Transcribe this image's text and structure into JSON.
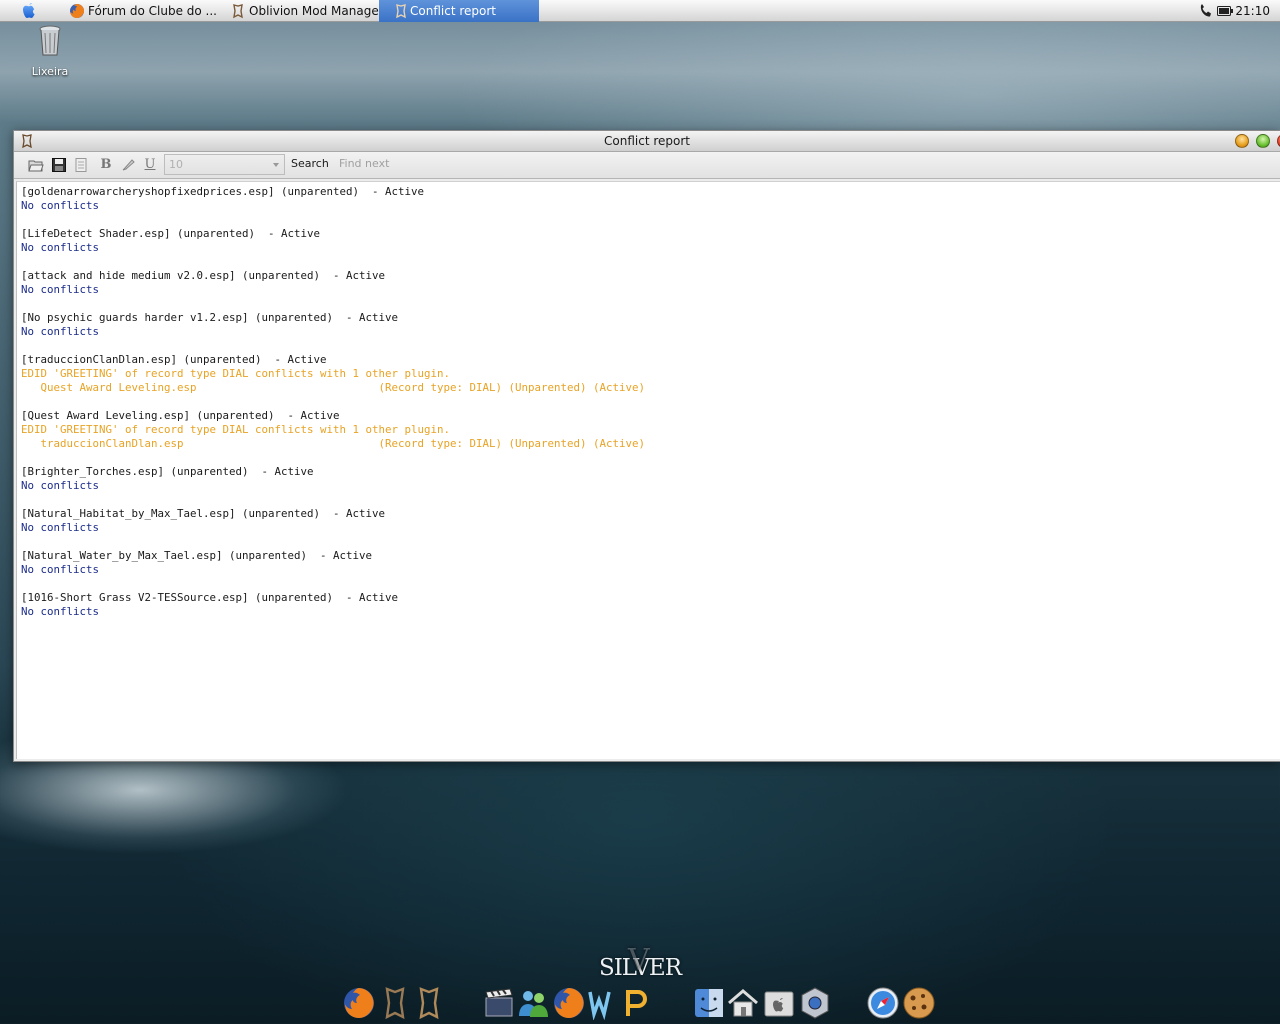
{
  "menubar": {
    "apple_icon": "apple-logo-icon",
    "tasks": [
      {
        "label": "Fórum do Clube do ...",
        "icon": "firefox-icon",
        "active": false
      },
      {
        "label": "Oblivion Mod Manager",
        "icon": "oblivion-mod-manager-icon",
        "active": false
      },
      {
        "label": "Conflict report",
        "icon": "oblivion-mod-manager-icon",
        "active": true
      }
    ],
    "tray_icons": [
      "phone-icon",
      "battery-icon"
    ],
    "clock": "21:10",
    "active_color": "#3a72c6"
  },
  "desktop": {
    "trash_label": "Lixeira"
  },
  "window": {
    "title": "Conflict report",
    "toolbar": {
      "font_size_value": "10",
      "search_label": "Search",
      "find_next_label": "Find next",
      "bold_label": "B",
      "underline_label": "U"
    },
    "report_lines": [
      {
        "text": "[goldenarrowarcheryshopfixedprices.esp] (unparented)  - Active",
        "kind": "hdr"
      },
      {
        "text": "No conflicts",
        "kind": "ok"
      },
      {
        "text": "",
        "kind": "blank"
      },
      {
        "text": "[LifeDetect Shader.esp] (unparented)  - Active",
        "kind": "hdr"
      },
      {
        "text": "No conflicts",
        "kind": "ok"
      },
      {
        "text": "",
        "kind": "blank"
      },
      {
        "text": "[attack and hide medium v2.0.esp] (unparented)  - Active",
        "kind": "hdr"
      },
      {
        "text": "No conflicts",
        "kind": "ok"
      },
      {
        "text": "",
        "kind": "blank"
      },
      {
        "text": "[No psychic guards harder v1.2.esp] (unparented)  - Active",
        "kind": "hdr"
      },
      {
        "text": "No conflicts",
        "kind": "ok"
      },
      {
        "text": "",
        "kind": "blank"
      },
      {
        "text": "[traduccionClanDlan.esp] (unparented)  - Active",
        "kind": "hdr"
      },
      {
        "text": "EDID 'GREETING' of record type DIAL conflicts with 1 other plugin.",
        "kind": "warn"
      },
      {
        "text": "   Quest Award Leveling.esp                            (Record type: DIAL) (Unparented) (Active)",
        "kind": "warn"
      },
      {
        "text": "",
        "kind": "blank"
      },
      {
        "text": "[Quest Award Leveling.esp] (unparented)  - Active",
        "kind": "hdr"
      },
      {
        "text": "EDID 'GREETING' of record type DIAL conflicts with 1 other plugin.",
        "kind": "warn"
      },
      {
        "text": "   traduccionClanDlan.esp                              (Record type: DIAL) (Unparented) (Active)",
        "kind": "warn"
      },
      {
        "text": "",
        "kind": "blank"
      },
      {
        "text": "[Brighter_Torches.esp] (unparented)  - Active",
        "kind": "hdr"
      },
      {
        "text": "No conflicts",
        "kind": "ok"
      },
      {
        "text": "",
        "kind": "blank"
      },
      {
        "text": "[Natural_Habitat_by_Max_Tael.esp] (unparented)  - Active",
        "kind": "hdr"
      },
      {
        "text": "No conflicts",
        "kind": "ok"
      },
      {
        "text": "",
        "kind": "blank"
      },
      {
        "text": "[Natural_Water_by_Max_Tael.esp] (unparented)  - Active",
        "kind": "hdr"
      },
      {
        "text": "No conflicts",
        "kind": "ok"
      },
      {
        "text": "",
        "kind": "blank"
      },
      {
        "text": "[1016-Short Grass V2-TESSource.esp] (unparented)  - Active",
        "kind": "hdr"
      },
      {
        "text": "No conflicts",
        "kind": "ok"
      }
    ],
    "colors": {
      "header_text": "#1a1a1a",
      "no_conflicts_text": "#1b2c8a",
      "conflict_text": "#e8a325"
    }
  },
  "dock": {
    "brand": "SILVER",
    "items": [
      {
        "name": "firefox-icon"
      },
      {
        "name": "oblivion-icon"
      },
      {
        "name": "oblivion-mod-manager-icon"
      },
      {
        "name": "movie-clapper-icon"
      },
      {
        "name": "messenger-icon"
      },
      {
        "name": "firefox-icon"
      },
      {
        "name": "writer-icon"
      },
      {
        "name": "presentation-icon"
      },
      {
        "name": "finder-icon"
      },
      {
        "name": "home-icon"
      },
      {
        "name": "applications-icon"
      },
      {
        "name": "system-preferences-icon"
      },
      {
        "name": "safari-icon"
      },
      {
        "name": "cookie-icon"
      }
    ]
  }
}
